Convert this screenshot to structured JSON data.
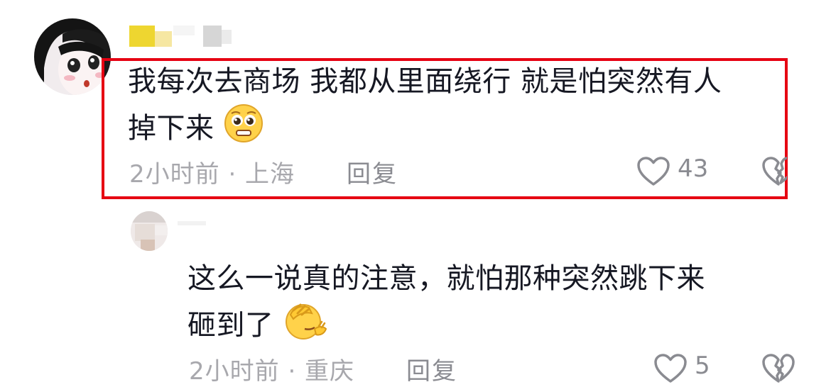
{
  "comments": [
    {
      "text_line1": "我每次去商场 我都从里面绕行 就是怕突然有人",
      "text_line2": "掉下来",
      "emoji": "pleading-face-emoji",
      "meta": "2小时前 · 上海",
      "reply_label": "回复",
      "like_count": "43",
      "highlighted": true,
      "highlight_color": "#e60012"
    },
    {
      "text_line1": "这么一说真的注意，就怕那种突然跳下来",
      "text_line2": "砸到了",
      "emoji": "facepalm-emoji",
      "meta": "2小时前 · 重庆",
      "reply_label": "回复",
      "like_count": "5",
      "highlighted": false
    }
  ],
  "colors": {
    "text": "#161823",
    "meta": "#a8a8ad",
    "action": "#8a8b91",
    "highlight": "#e60012"
  }
}
